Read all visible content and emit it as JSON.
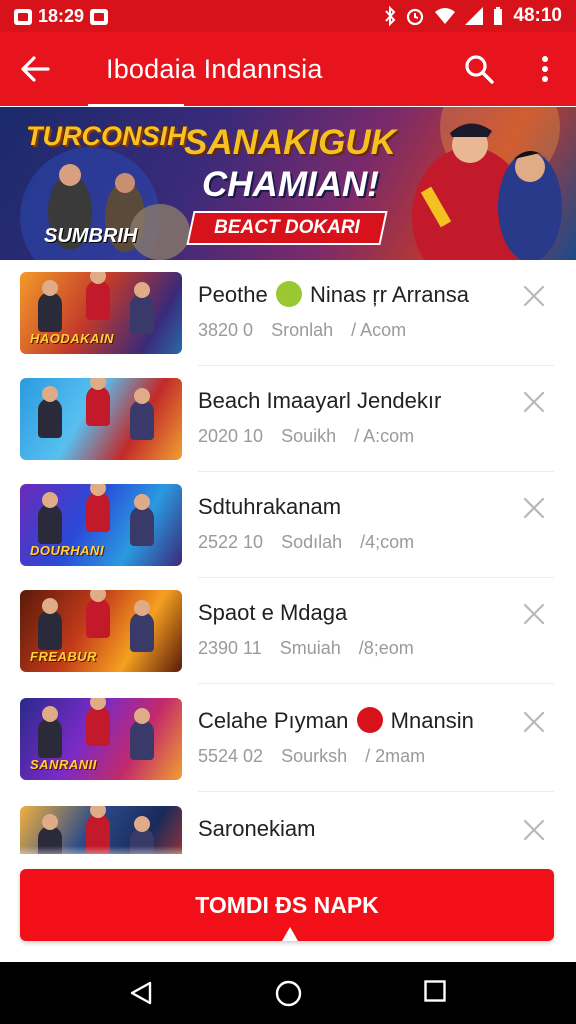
{
  "status_bar": {
    "time_left": "18:29",
    "time_right": "48:10"
  },
  "app_bar": {
    "title": "Ibodaia Indannsia"
  },
  "banner": {
    "left_title": "TURCONSIH",
    "left_badge": "SUMBRIH",
    "headline_1": "SANAKIGUK",
    "headline_2": "CHAMIAN!",
    "ribbon": "BEACT DOKARI"
  },
  "list": {
    "items": [
      {
        "name_a": "Peothe",
        "name_b": "Ninas ŗr Arransa",
        "has_badge": true,
        "badge_color": "#9ac832",
        "id": "3820 0",
        "region": "Sronlah",
        "site": "/ Acom",
        "thumb_label": "HAODAKAIN",
        "thumb_bg": "linear-gradient(120deg,#f39a2a,#c23a2a 45%,#3a2a7a 80%,#2a6aa8)"
      },
      {
        "name_a": "Beach Imaayarl Jendekır",
        "name_b": "",
        "has_badge": false,
        "badge_color": "",
        "id": "2020 10",
        "region": "Souikh",
        "site": "/ A:com",
        "thumb_label": "",
        "thumb_bg": "linear-gradient(120deg,#2a9ae0,#58c0f0 40%,#c22a2a 70%,#f0a030)"
      },
      {
        "name_a": "Sdtuhrakanam",
        "name_b": "",
        "has_badge": false,
        "badge_color": "",
        "id": "2522 10",
        "region": "Sodılah",
        "site": "/4;com",
        "thumb_label": "DOURHANI",
        "thumb_bg": "linear-gradient(120deg,#6a2ab8,#2a4ad8 40%,#2a9ae0 70%,#3a2a7a)"
      },
      {
        "name_a": "Spaot e Mdaga",
        "name_b": "",
        "has_badge": false,
        "badge_color": "",
        "id": "2390 11",
        "region": "Smuiah",
        "site": "/8;eom",
        "thumb_label": "FREABUR",
        "thumb_bg": "linear-gradient(120deg,#5a1a0a,#c23a1a 40%,#f5a020 70%,#5a1a0a)"
      },
      {
        "name_a": "Celahe Pıyman",
        "name_b": "Mnansin",
        "has_badge": true,
        "badge_color": "#d8121b",
        "id": "5524 02",
        "region": "Sourksh",
        "site": "/ 2mam",
        "thumb_label": "SANRANII",
        "thumb_bg": "linear-gradient(120deg,#2a2a8a,#7a2ac8 40%,#c22a6a 70%,#f0a030)"
      },
      {
        "name_a": "Saronekiam",
        "name_b": "",
        "has_badge": false,
        "badge_color": "",
        "id": "",
        "region": "",
        "site": "",
        "thumb_label": "",
        "thumb_bg": "linear-gradient(120deg,#f0b040,#2a4a8a 40%,#1a2a5a 70%,#c23a2a)"
      }
    ]
  },
  "cta": {
    "label": "TOMDI ĐS NAPK"
  },
  "colors": {
    "brand": "#e8141d",
    "status_bar": "#d8121b",
    "cta": "#f20f18"
  }
}
